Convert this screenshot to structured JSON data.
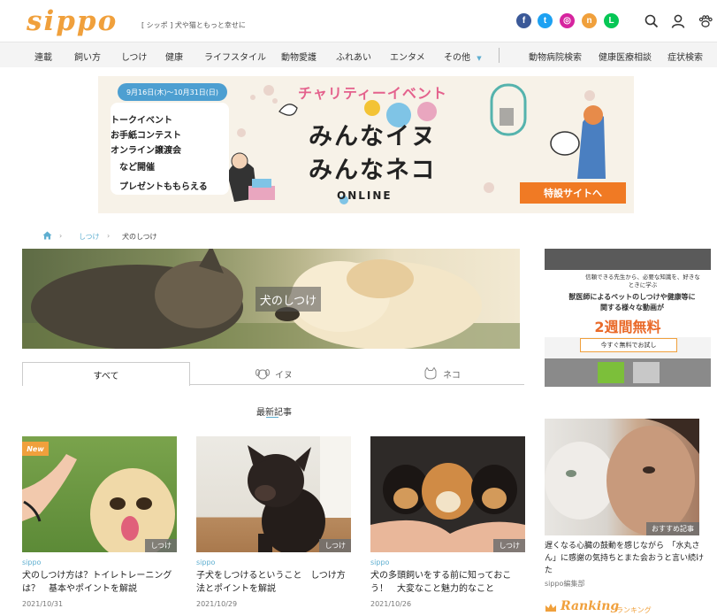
{
  "header": {
    "logo": "sippo",
    "tagline": "[ シッポ ] 犬や猫ともっと幸せに",
    "social": [
      {
        "name": "facebook",
        "glyph": "f",
        "color": "#3b5998"
      },
      {
        "name": "twitter",
        "glyph": "t",
        "color": "#1da1f2"
      },
      {
        "name": "instagram",
        "glyph": "◎",
        "color": "#d6249f"
      },
      {
        "name": "note",
        "glyph": "n",
        "color": "#f0a03c"
      },
      {
        "name": "line",
        "glyph": "L",
        "color": "#06c755"
      }
    ]
  },
  "nav": {
    "items": [
      "連載",
      "飼い方",
      "しつけ",
      "健康",
      "ライフスタイル",
      "動物愛護",
      "ふれあい",
      "エンタメ",
      "その他"
    ],
    "right": [
      "動物病院検索",
      "健康医療相談",
      "症状検索"
    ]
  },
  "banner": {
    "date": "9月16日(木)〜10月31日(日)",
    "lines": [
      "トークイベント",
      "お手紙コンテスト",
      "オンライン譲渡会",
      "など開催",
      "プレゼントももらえる"
    ],
    "charity": "チャリティーイベント",
    "title1": "みんなイヌ",
    "title2": "みんなネコ",
    "online": "ONLINE",
    "cta": "特設サイトへ"
  },
  "breadcrumb": {
    "level1": "しつけ",
    "level2": "犬のしつけ"
  },
  "hero": {
    "title": "犬のしつけ"
  },
  "tabs": {
    "all": "すべて",
    "dog": "イヌ",
    "cat": "ネコ"
  },
  "latest_label": "最新記事",
  "cards": [
    {
      "badge": "New",
      "category": "しつけ",
      "source": "sippo",
      "title": "犬のしつけ方は？トイレトレーニングは？　基本やポイントを解説",
      "date": "2021/10/31"
    },
    {
      "badge": "",
      "category": "しつけ",
      "source": "sippo",
      "title": "子犬をしつけるということ　しつけ方法とポイントを解説",
      "date": "2021/10/29"
    },
    {
      "badge": "",
      "category": "しつけ",
      "source": "sippo",
      "title": "犬の多頭飼いをする前に知っておこう！　大変なこと魅力的なこと",
      "date": "2021/10/26"
    }
  ],
  "ad": {
    "headline": "信頼できる先生から、必要な知識を、好きなときに学ぶ",
    "body": "獣医師によるペットのしつけや健康等に関する様々な動画が",
    "highlight": "2週間無料",
    "cta": "今すぐ無料でお試し"
  },
  "sidebar": {
    "badge": "おすすめ記事",
    "title": "遅くなる心臓の鼓動を感じながら　「水丸さん」に感謝の気持ちとまた会おうと言い続けた",
    "author": "sippo編集部",
    "ranking": "Ranking",
    "ranking_sub": "ランキング"
  }
}
